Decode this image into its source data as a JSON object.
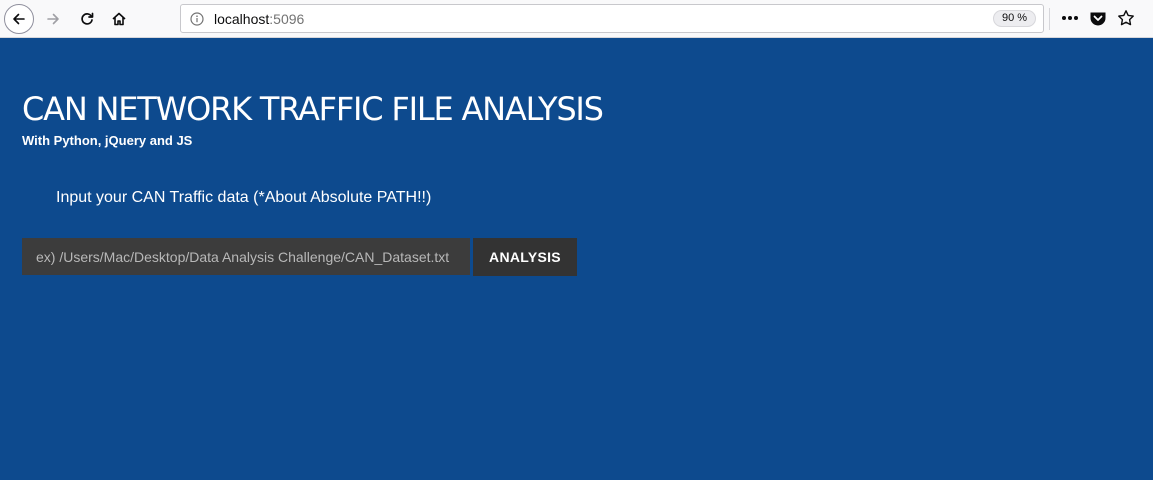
{
  "browser": {
    "url_host": "localhost",
    "url_port": ":5096",
    "zoom": "90 %",
    "icons": [
      "back-icon",
      "forward-icon",
      "reload-icon",
      "home-icon",
      "info-icon",
      "more-icon",
      "pocket-icon",
      "bookmark-star-icon"
    ]
  },
  "page": {
    "title": "CAN NETWORK TRAFFIC FILE ANALYSIS",
    "subtitle": "With Python, jQuery and JS",
    "instruction": "Input your CAN Traffic data (*About Absolute PATH!!)",
    "input_placeholder": "ex) /Users/Mac/Desktop/Data Analysis Challenge/CAN_Dataset.txt",
    "input_value": "",
    "analysis_button": "ANALYSIS"
  },
  "colors": {
    "background": "#0d4a8e",
    "input_bg": "#3c3c3c",
    "button_bg": "#333333",
    "text": "#ffffff"
  }
}
